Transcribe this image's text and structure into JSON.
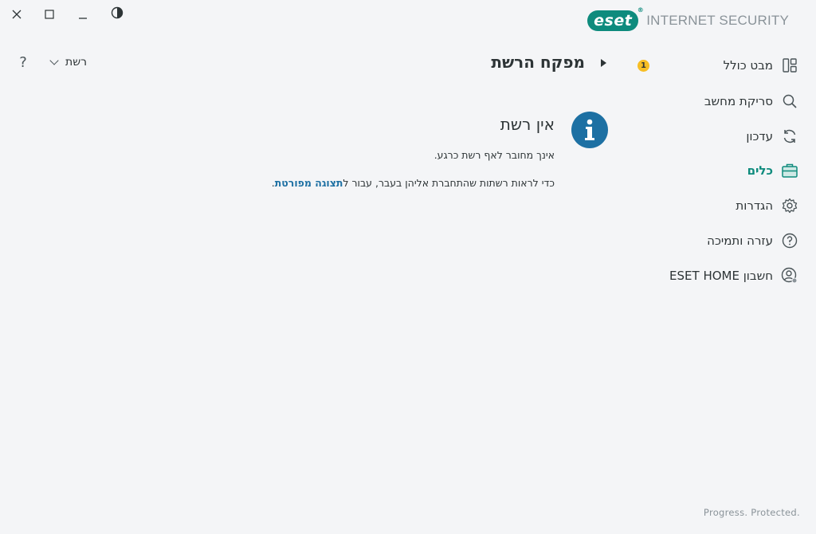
{
  "window_controls": {
    "close_icon": "close-icon",
    "maximize_icon": "maximize-icon",
    "minimize_icon": "minimize-icon",
    "theme_icon": "contrast-icon"
  },
  "brand": {
    "logo_text": "eset",
    "product_name": "INTERNET SECURITY",
    "accent_color": "#0e8b7d"
  },
  "sidebar": {
    "items": [
      {
        "label": "מבט כולל",
        "icon": "dashboard-icon",
        "badge": "1",
        "active": false
      },
      {
        "label": "סריקת מחשב",
        "icon": "search-icon",
        "active": false
      },
      {
        "label": "עדכון",
        "icon": "refresh-icon",
        "active": false
      },
      {
        "label": "כלים",
        "icon": "toolbox-icon",
        "active": true
      },
      {
        "label": "הגדרות",
        "icon": "gear-icon",
        "active": false
      },
      {
        "label": "עזרה ותמיכה",
        "icon": "help-circle-icon",
        "active": false
      },
      {
        "label": "חשבון ESET HOME",
        "icon": "account-icon",
        "active": false
      }
    ]
  },
  "header": {
    "title": "מפקח הרשת",
    "network_dropdown": "רשת",
    "help": "?"
  },
  "main": {
    "info_title": "אין רשת",
    "line1": "אינך מחובר לאף רשת כרגע.",
    "line2_prefix": "כדי לראות רשתות שהתחברת אליהן בעבר, עבור ל",
    "line2_link": "תצוגה מפורטת",
    "line2_suffix": "."
  },
  "footer": {
    "tagline": "Progress. Protected."
  }
}
